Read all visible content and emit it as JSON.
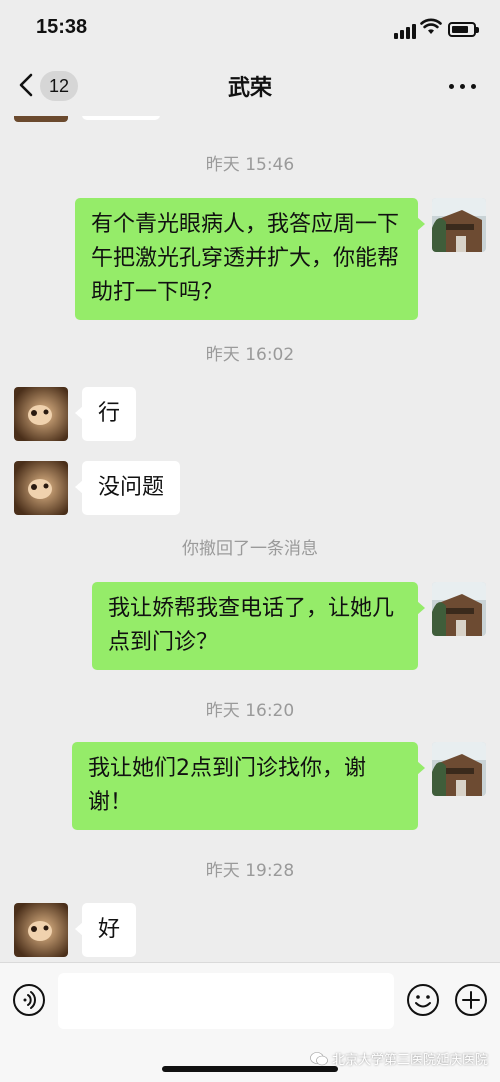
{
  "status_bar": {
    "time": "15:38"
  },
  "nav": {
    "unread_count": "12",
    "title": "武荣"
  },
  "messages": [
    {
      "type": "timestamp",
      "text": "昨天 15:46"
    },
    {
      "type": "out",
      "text": "有个青光眼病人，我答应周一下午把激光孔穿透并扩大，你能帮助打一下吗？"
    },
    {
      "type": "timestamp",
      "text": "昨天 16:02"
    },
    {
      "type": "in",
      "text": "行"
    },
    {
      "type": "in",
      "text": "没问题"
    },
    {
      "type": "notice",
      "text": "你撤回了一条消息"
    },
    {
      "type": "out",
      "text": "我让娇帮我查电话了，让她几点到门诊？"
    },
    {
      "type": "timestamp",
      "text": "昨天 16:20"
    },
    {
      "type": "out",
      "text": "我让她们2点到门诊找你，谢谢！"
    },
    {
      "type": "timestamp",
      "text": "昨天 19:28"
    },
    {
      "type": "in",
      "text": "好"
    }
  ],
  "input": {
    "value": ""
  },
  "watermark": {
    "text": "北京大学第三医院延庆医院"
  },
  "colors": {
    "outgoing_bubble": "#95ec69",
    "incoming_bubble": "#ffffff",
    "background": "#ededed"
  }
}
